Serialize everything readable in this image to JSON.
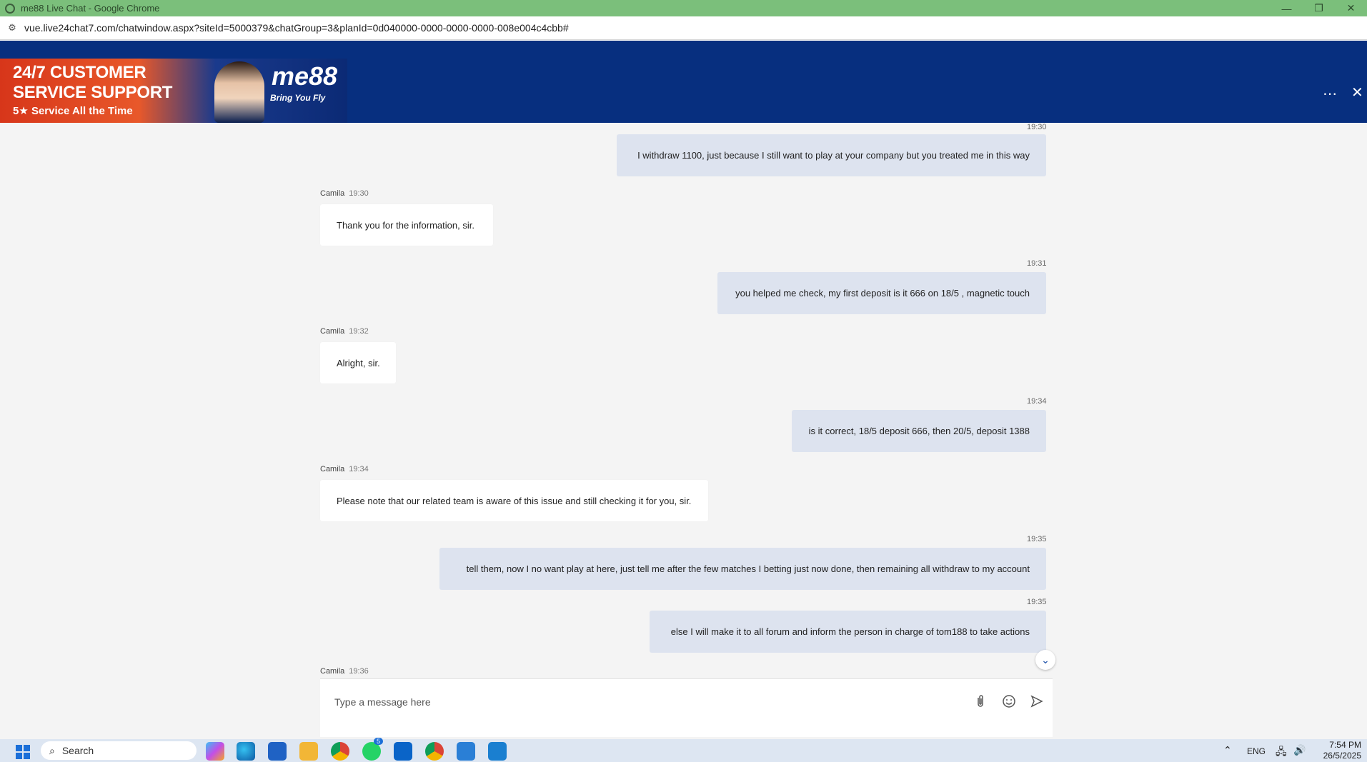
{
  "window": {
    "title": "me88 Live Chat - Google Chrome",
    "url": "vue.live24chat7.com/chatwindow.aspx?siteId=5000379&chatGroup=3&planId=0d040000-0000-0000-0000-008e004c4cbb#"
  },
  "banner": {
    "line1": "24/7 CUSTOMER",
    "line2": "SERVICE SUPPORT",
    "line3": "5★ Service All the Time",
    "logo": "me88",
    "tagline": "Bring You Fly"
  },
  "header": {
    "more_icon": "⋯",
    "close_icon": "✕"
  },
  "messages": [
    {
      "type": "out",
      "time": "19:30",
      "text": "I withdraw 1100, just because I still want to play at your company but you treated me in this way"
    },
    {
      "type": "in",
      "sender": "Camila",
      "time": "19:30",
      "text": "Thank you for the information, sir."
    },
    {
      "type": "out",
      "time": "19:31",
      "text": "you helped me check, my first deposit is it 666 on 18/5 , magnetic touch"
    },
    {
      "type": "in",
      "sender": "Camila",
      "time": "19:32",
      "text": "Alright, sir."
    },
    {
      "type": "out",
      "time": "19:34",
      "text": "is it correct, 18/5 deposit 666, then 20/5, deposit 1388"
    },
    {
      "type": "in",
      "sender": "Camila",
      "time": "19:34",
      "text": "Please note that our related team is aware of this issue and still checking it for you, sir."
    },
    {
      "type": "out",
      "time": "19:35",
      "text": "tell them, now I no want play at here, just tell me after the few matches I betting just now done, then remaining all withdraw to my account"
    },
    {
      "type": "out",
      "time": "19:35",
      "text": "else I will make it to all forum and inform the person in charge of tom188 to take actions"
    },
    {
      "type": "in-pending",
      "sender": "Camila",
      "time": "19:36"
    }
  ],
  "composer": {
    "placeholder": "Type a message here"
  },
  "taskbar": {
    "search_label": "Search",
    "whatsapp_badge": "5",
    "lang": "ENG",
    "time": "7:54 PM",
    "date": "26/5/2025"
  }
}
